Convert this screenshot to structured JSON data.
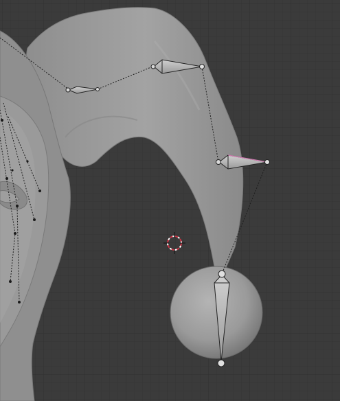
{
  "viewport": {
    "mode": "3d-viewport",
    "background_color": "#3b3b3b",
    "grid_minor_color": "#363636",
    "grid_major_color": "#2f2f2f"
  },
  "scene": {
    "mesh_color": "#9a9a9a",
    "bone_color": "#b8b8b8",
    "bone_selected_edge_color": "#d07ab0",
    "relationship_line_color": "#1e1e1e",
    "cursor_color": "#cc3344",
    "objects": [
      {
        "kind": "jester-head-mesh",
        "icon": "mesh-icon"
      },
      {
        "kind": "hat-tail-mesh",
        "icon": "mesh-icon"
      },
      {
        "kind": "pompom-sphere",
        "icon": "sphere-icon"
      },
      {
        "kind": "armature",
        "icon": "bone-icon",
        "bone_count_visible": 4
      },
      {
        "kind": "3d-cursor",
        "icon": "crosshair-icon"
      }
    ]
  }
}
